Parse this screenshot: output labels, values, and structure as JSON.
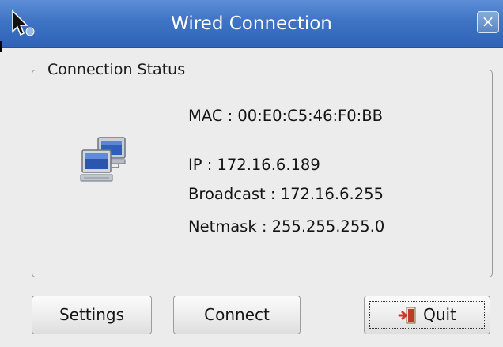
{
  "window": {
    "title": "Wired Connection",
    "close_label": "×"
  },
  "status_group": {
    "legend": "Connection Status",
    "mac": "MAC : 00:E0:C5:46:F0:BB",
    "ip": "IP : 172.16.6.189",
    "broadcast": "Broadcast : 172.16.6.255",
    "netmask": "Netmask : 255.255.255.0"
  },
  "buttons": {
    "settings": "Settings",
    "connect": "Connect",
    "quit": "Quit"
  },
  "icons": {
    "title": "arrow-cursor-icon",
    "network": "network-computers-icon",
    "quit": "exit-door-icon",
    "close": "close-icon"
  },
  "colors": {
    "titlebar": "#3f73c4",
    "window_bg": "#ececec",
    "quit_icon": "#d4322c"
  }
}
